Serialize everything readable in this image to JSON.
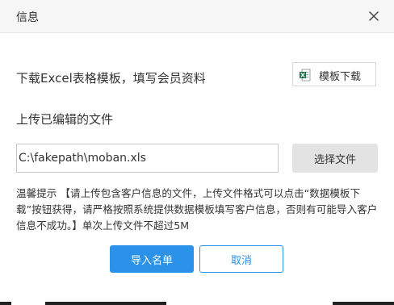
{
  "dialog": {
    "title": "信息",
    "close_icon": "close-icon"
  },
  "download": {
    "label": "下载Excel表格模板，填写会员资料",
    "button_label": "模板下载",
    "button_icon": "excel-icon"
  },
  "upload": {
    "label": "上传已编辑的文件",
    "file_value": "C:\\fakepath\\moban.xls",
    "choose_label": "选择文件"
  },
  "tips": {
    "text": "温馨提示 【请上传包含客户信息的文件，上传文件格式可以点击“数据模板下载”按钮获得，请严格按照系统提供数据模板填写客户信息，否则有可能导入客户信息不成功。】单次上传文件不超过5M"
  },
  "actions": {
    "import_label": "导入名单",
    "cancel_label": "取消"
  },
  "colors": {
    "primary": "#2a92e8",
    "header_bg": "#f6f6f6",
    "excel_green": "#1e7145"
  }
}
